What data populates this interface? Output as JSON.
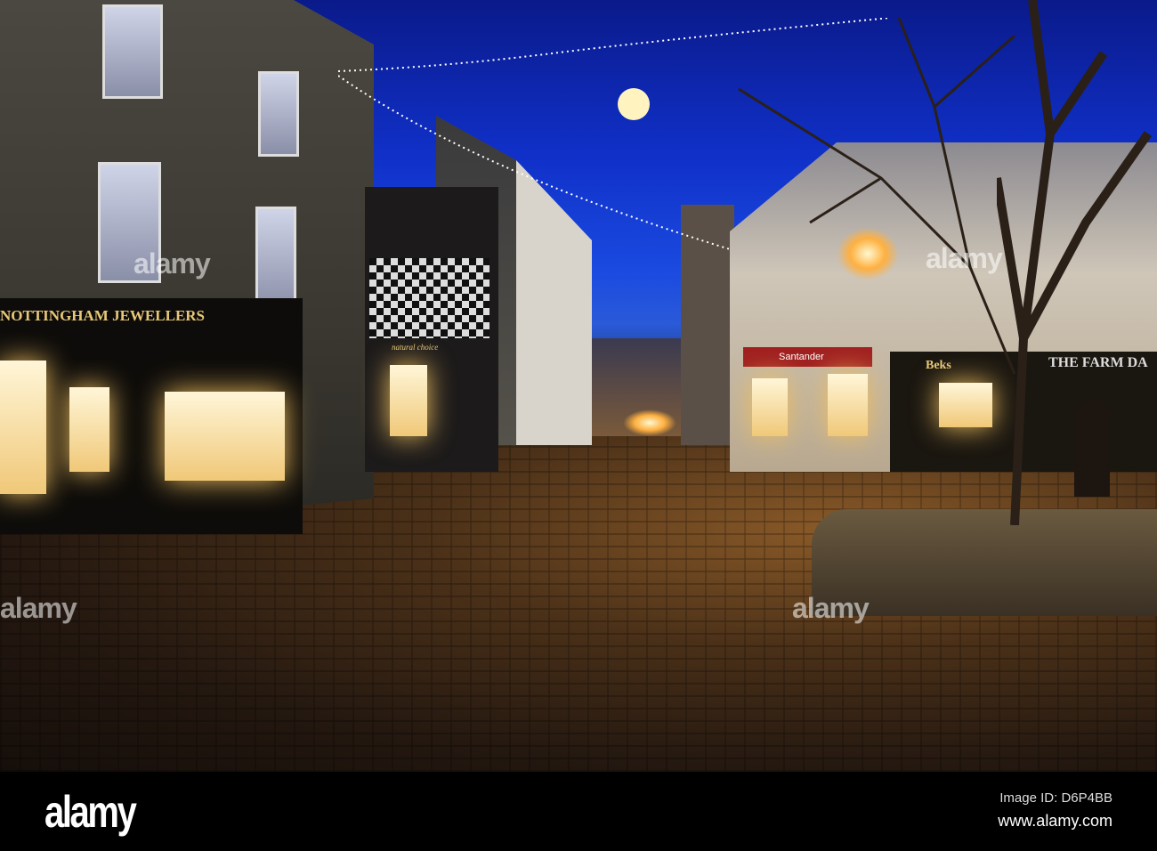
{
  "photo": {
    "signs": {
      "jewellers": "NOTTINGHAM JEWELLERS",
      "natural_choice": "natural choice",
      "santander": "Santander",
      "beks": "Beks",
      "farm_dairy": "THE FARM DA"
    },
    "watermark": "alamy",
    "colors": {
      "sky": "#1a4ae0",
      "street": "#4a3018",
      "lamp": "#ffb040"
    }
  },
  "footer": {
    "logo": "alamy",
    "image_id": "Image ID: D6P4BB",
    "url": "www.alamy.com"
  }
}
